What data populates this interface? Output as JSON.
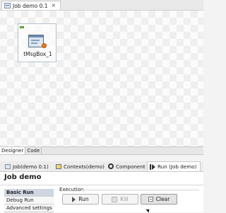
{
  "editor": {
    "tab_title": "Job demo 0.1",
    "tab_close": "×"
  },
  "canvas": {
    "component_label": "tMsgBox_1"
  },
  "view_tabs": [
    "Designer",
    "Code"
  ],
  "panel_tabs": [
    {
      "label": "Job(demo 0.1)",
      "icon": "job-icon"
    },
    {
      "label": "Contexts(demo)",
      "icon": "contexts-icon"
    },
    {
      "label": "Component",
      "icon": "component-icon"
    },
    {
      "label": "Run (Job demo)",
      "icon": "run-icon",
      "active": true
    }
  ],
  "run_panel": {
    "title": "Job demo",
    "nav": [
      "Basic Run",
      "Debug Run",
      "Advanced settings"
    ],
    "selected_nav": "Basic Run",
    "section": "Execution",
    "buttons": {
      "run": "Run",
      "kill": "Kill",
      "clear": "Clear"
    }
  },
  "colors": {
    "badge_green": "#8bcc52",
    "warning_orange": "#f07c14",
    "selected_nav_bg": "#cfd6e1"
  }
}
